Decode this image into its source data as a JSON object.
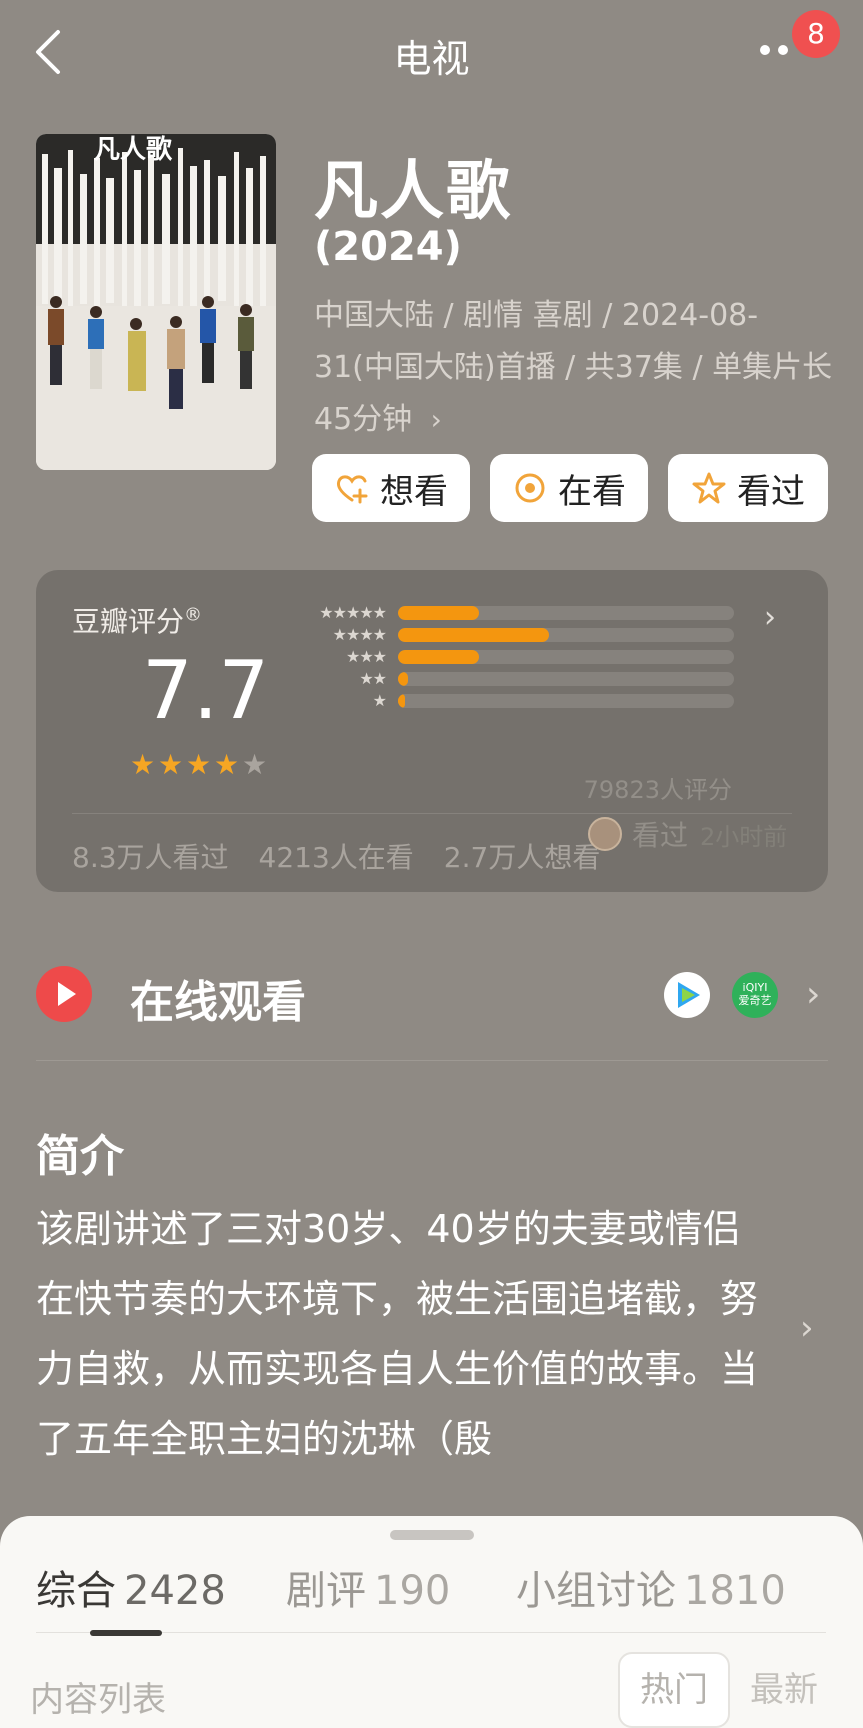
{
  "nav": {
    "title": "电视",
    "badge": "8"
  },
  "movie": {
    "title": "凡人歌",
    "year": "(2024)",
    "meta": "中国大陆 / 剧情 喜剧 / 2024-08-31(中国大陆)首播 / 共37集 / 单集片长45分钟",
    "poster_title": "凡人歌"
  },
  "actions": {
    "want": "想看",
    "watching": "在看",
    "watched": "看过"
  },
  "rating": {
    "label": "豆瓣评分",
    "registered": "®",
    "score": "7.7",
    "stars": 4,
    "distribution": [
      {
        "stars": "★★★★★",
        "fraction": 0.24
      },
      {
        "stars": "★★★★",
        "fraction": 0.45
      },
      {
        "stars": "★★★",
        "fraction": 0.24
      },
      {
        "stars": "★★",
        "fraction": 0.03
      },
      {
        "stars": "★",
        "fraction": 0.02
      }
    ],
    "count": "79823人评分",
    "stats": {
      "watched": "8.3万人看过",
      "watching": "4213人在看",
      "want": "2.7万人想看"
    },
    "friend": {
      "status": "看过",
      "time": "2小时前"
    }
  },
  "watch": {
    "label": "在线观看",
    "platforms": [
      "腾讯视频",
      "爱奇艺"
    ],
    "iqiyi_line1": "iQIYI",
    "iqiyi_line2": "爱奇艺"
  },
  "intro": {
    "heading": "简介",
    "text": "该剧讲述了三对30岁、40岁的夫妻或情侣在快节奏的大环境下，被生活围追堵截，努力自救，从而实现各自人生价值的故事。当了五年全职主妇的沈琳（殷"
  },
  "tabs": [
    {
      "label": "综合",
      "count": "2428"
    },
    {
      "label": "剧评",
      "count": "190"
    },
    {
      "label": "小组讨论",
      "count": "1810"
    }
  ],
  "list": {
    "label": "内容列表",
    "sort_hot": "热门",
    "sort_new": "最新"
  },
  "colors": {
    "accent": "#f4960f",
    "badge": "#f05050",
    "play": "#ee4a4a"
  }
}
